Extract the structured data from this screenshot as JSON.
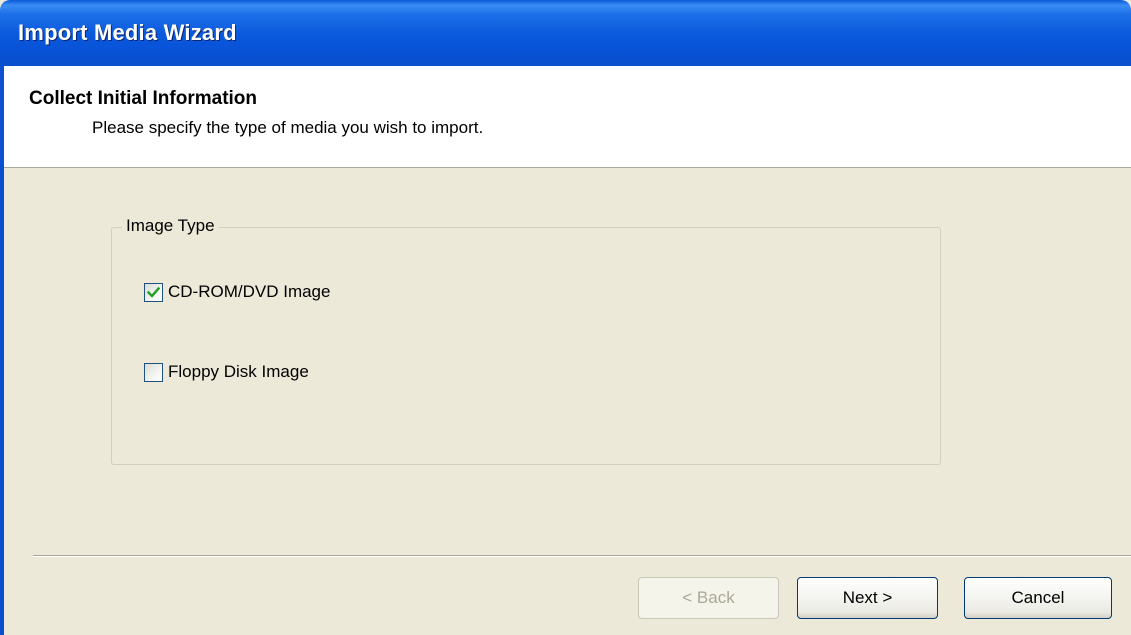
{
  "window": {
    "title": "Import Media Wizard"
  },
  "header": {
    "title": "Collect Initial Information",
    "subtitle": "Please specify the type of media you wish to import."
  },
  "image_type": {
    "legend": "Image Type",
    "options": [
      {
        "label": "CD-ROM/DVD Image",
        "checked": true
      },
      {
        "label": "Floppy Disk Image",
        "checked": false
      }
    ]
  },
  "buttons": {
    "back": {
      "label": "< Back",
      "enabled": false
    },
    "next": {
      "label": "Next >",
      "enabled": true
    },
    "cancel": {
      "label": "Cancel",
      "enabled": true
    }
  },
  "colors": {
    "titlebar": "#0a58dc",
    "dialog_bg": "#ece9d8",
    "check_mark": "#21a121",
    "button_border": "#003c74"
  }
}
